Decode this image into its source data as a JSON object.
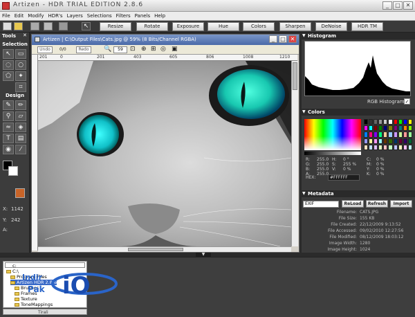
{
  "window": {
    "title": "Artizen - HDR TRIAL EDITION 2.8.6"
  },
  "menu": [
    "File",
    "Edit",
    "Modify",
    "HDR's",
    "Layers",
    "Selections",
    "Filters",
    "Panels",
    "Help"
  ],
  "toolbar": {
    "buttons": [
      "Resize",
      "Rotate",
      "Exposure",
      "Hue",
      "Colors",
      "Sharpen",
      "DeNoise",
      "HDR TM"
    ]
  },
  "tools": {
    "header": "Tools",
    "close": "✕",
    "selection": "Selection",
    "design": "Design",
    "x_label": "X:",
    "x_val": "1142",
    "y_label": "Y:",
    "y_val": "242",
    "a_label": "A:"
  },
  "document": {
    "title": "Artizen | C:\\Output Files\\Cats.jpg @ 59% (8 Bits/Channel RGBA)",
    "undo": "Undo",
    "counter": "0/0",
    "redo": "Redo",
    "zoom": "59",
    "ruler": [
      "201",
      "0",
      "201",
      "403",
      "605",
      "806",
      "1008",
      "1210"
    ]
  },
  "histogram": {
    "header": "Histogram",
    "label": "RGB Histogram",
    "checked": "✓"
  },
  "colors": {
    "header": "Colors",
    "rows": [
      [
        "R:",
        "255.0",
        "H:",
        "0 °",
        "C:",
        "0 %"
      ],
      [
        "G:",
        "255.0",
        "S:",
        "255 %",
        "M:",
        "0 %"
      ],
      [
        "B:",
        "255.0",
        "V:",
        "0 %",
        "Y:",
        "0 %"
      ],
      [
        "A:",
        "255.0",
        "",
        "",
        "K:",
        "0 %"
      ]
    ],
    "hex_label": "HEX:",
    "hex": "#FFFFFF",
    "swatches": [
      "#000000",
      "#333333",
      "#666666",
      "#999999",
      "#cccccc",
      "#ffffff",
      "#ff0000",
      "#00ff00",
      "#0000ff",
      "#ffff00",
      "#ff00ff",
      "#00ffff",
      "#800000",
      "#008000",
      "#000080",
      "#808000",
      "#800080",
      "#008080",
      "#ff8000",
      "#80ff00",
      "#0080ff",
      "#ff0080",
      "#8000ff",
      "#00ff80",
      "#ffcc99",
      "#99ccff",
      "#cc99ff",
      "#ccff99",
      "#ff9999",
      "#99ff99",
      "#9999ff",
      "#ffff99",
      "#ff99ff",
      "#99ffff",
      "#663300",
      "#336600",
      "#003366",
      "#660033",
      "#330066",
      "#006633",
      "#ffe0c0",
      "#c0e0ff",
      "#e0c0ff",
      "#e0ffc0",
      "#ffc0c0",
      "#c0ffc0",
      "#c0c0ff",
      "#ffffc0",
      "#ffc0ff",
      "#c0ffff"
    ]
  },
  "metadata": {
    "header": "Metadata",
    "select": "EXIF",
    "buttons": [
      "ReLoad",
      "Refresh",
      "Import"
    ],
    "rows": [
      [
        "Filename:",
        "CATS.JPG"
      ],
      [
        "File Size:",
        "155 KB"
      ],
      [
        "File Created:",
        "22/12/2009 9:13:52"
      ],
      [
        "File Accessed:",
        "09/02/2010 12:27:56"
      ],
      [
        "File Modified:",
        "08/12/2009 18:03:12"
      ],
      [
        "Image Width:",
        "1280"
      ],
      [
        "Image Height:",
        "1024"
      ]
    ]
  },
  "browser": {
    "drive": "c:",
    "items": [
      "C:\\",
      "Program Files",
      "Artizen HDR 2.8.6",
      "Brushes",
      "Frames",
      "Texture",
      "ToneMappings"
    ],
    "tab": "Tirali"
  },
  "logo": {
    "text": "Indir Pak",
    "mark": "iO"
  }
}
